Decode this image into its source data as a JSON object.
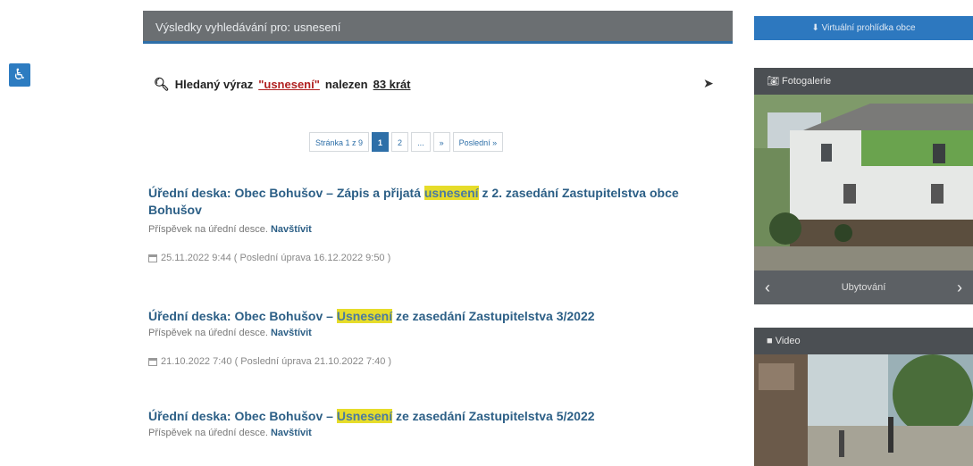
{
  "header": {
    "title": "Výsledky vyhledávání pro: usnesení"
  },
  "search": {
    "prefix": "Hledaný výraz",
    "term": "\"usnesení\"",
    "middle": "nalezen",
    "count": "83 krát"
  },
  "pagination": {
    "page_info": "Stránka 1 z 9",
    "current": "1",
    "next_page": "2",
    "ellipsis": "...",
    "next": "»",
    "last": "Poslední »"
  },
  "results": [
    {
      "title_before": "Úřední deska: Obec Bohušov – Zápis a přijatá ",
      "highlight": "usnesení",
      "title_after": " z 2. zasedání Zastupitelstva obce Bohušov",
      "meta": "Příspěvek na úřední desce.",
      "visit": "Navštívit",
      "date": "25.11.2022 9:44 ( Poslední úprava 16.12.2022 9:50 )"
    },
    {
      "title_before": "Úřední deska: Obec Bohušov – ",
      "highlight": "Usnesení",
      "title_after": " ze zasedání Zastupitelstva 3/2022",
      "meta": "Příspěvek na úřední desce.",
      "visit": "Navštívit",
      "date": "21.10.2022 7:40 ( Poslední úprava 21.10.2022 7:40 )"
    },
    {
      "title_before": "Úřední deska: Obec Bohušov – ",
      "highlight": "Usnesení",
      "title_after": " ze zasedání Zastupitelstva 5/2022",
      "meta": "Příspěvek na úřední desce.",
      "visit": "Navštívit"
    }
  ],
  "sidebar": {
    "virtual_tour": "Virtuální prohlídka obce",
    "gallery_title": "Fotogalerie",
    "gallery_caption": "Ubytování",
    "video_title": "Video"
  },
  "colors": {
    "accent": "#2d78bf",
    "highlight": "#e6dc2a",
    "link": "#2c5f86"
  }
}
